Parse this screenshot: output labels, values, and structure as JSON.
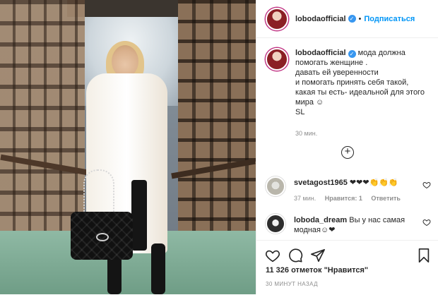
{
  "post": {
    "username": "lobodaofficial",
    "follow_label": "Подписаться",
    "separator": "•",
    "caption_text": "мода должна\nпомогать женщине .\nдавать ей уверенности\nи помогать принять себя такой,\nкакая ты есть- идеальной для этого\nмира ☺\nSL",
    "caption_time": "30 мин."
  },
  "comments": [
    {
      "username": "svetagost1965",
      "text": "❤❤❤👏👏👏",
      "time": "37 мин.",
      "likes_label": "Нравится: 1",
      "reply_label": "Ответить"
    },
    {
      "username": "loboda_dream",
      "text": "Вы у нас самая модная☺❤"
    }
  ],
  "footer": {
    "likes_count": "11 326",
    "likes_word": "отметок \"Нравится\"",
    "timestamp": "30 МИНУТ НАЗАД"
  },
  "colors": {
    "accent_blue": "#0095f6",
    "verified_blue": "#3897f0",
    "text": "#262626",
    "muted": "#8e8e8e"
  }
}
